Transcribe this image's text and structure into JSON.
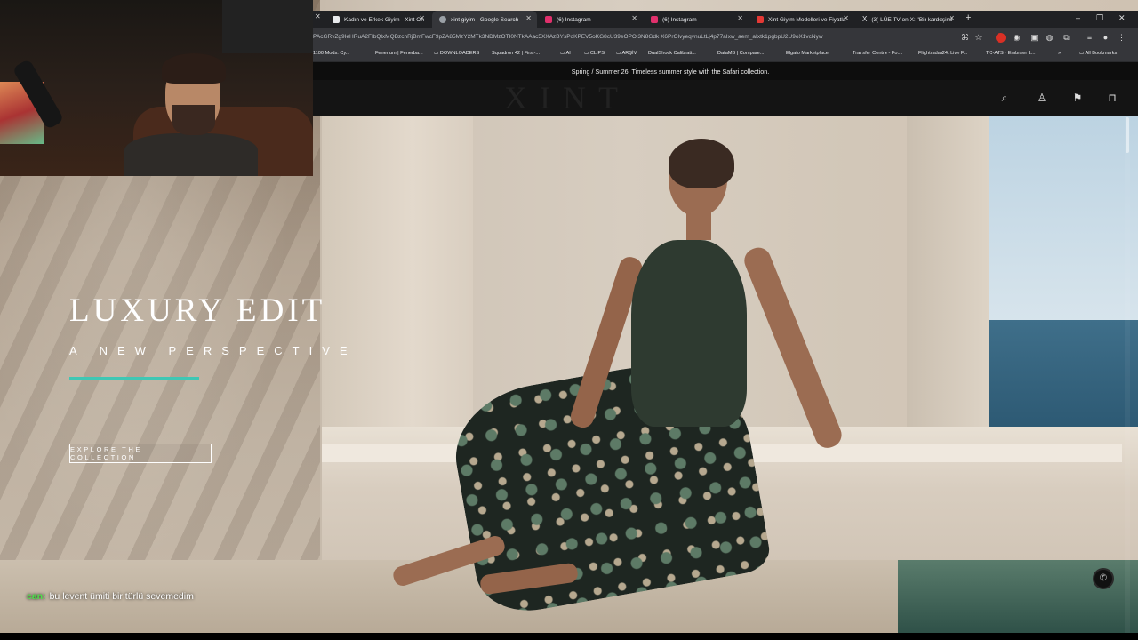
{
  "browser": {
    "tabs": [
      {
        "label": "Kadın ve Erkek Giyim - Xint On",
        "favicon_color": "#e8eaed"
      },
      {
        "label": "xint giyim - Google Search",
        "favicon_color": "#9aa0a6"
      },
      {
        "label": "(6) Instagram",
        "favicon_color": "#e1306c"
      },
      {
        "label": "(6) Instagram",
        "favicon_color": "#e1306c"
      },
      {
        "label": "Xint Giyim Modelleri ve Fiyatla",
        "favicon_color": "#e53935"
      },
      {
        "label": "(3) LÜE TV on X: \"Bir kardeşimi",
        "favicon_color": "#e8eaed"
      }
    ],
    "url": "PAcGRvZg9IeHRuA2FIbQlxMQBzcnRjBmFwcF9pZA85MzY2MTk3NDMzOTI0NTkAAac5XXAzBYsPoKPEV5oKG8cU39eOPOi3N8Gdk X6PrOlvyeqvnuLtLj4p77aIxw_aem_aIxtk1pgbpU2U9oX1vcNyw",
    "bookmarks": [
      "1100 Mods. Cy...",
      "Fenerium | Fenerba...",
      "DOWNLOADERS",
      "Squadron 42 | First-...",
      "AI",
      "CLIPS",
      "ARŞİV",
      "DualShock Calibrati...",
      "DataMB | Compare...",
      "Elgato Marketplace",
      "Transfer Centre - Fo...",
      "Flightradar24: Live F...",
      "TC-ATS - Embraer L...",
      "»",
      "All Bookmarks"
    ]
  },
  "site": {
    "promo": "Spring / Summer 26: Timeless summer style with the Safari collection.",
    "logo": "XINT",
    "hero_title": "LUXURY EDIT",
    "hero_subtitle": "A NEW PERSPECTIVE",
    "cta": "EXPLORE THE COLLECTION",
    "accent": "#3fc7b4"
  },
  "chat": {
    "user": "can:",
    "message": "bu levent ümiti bir türlü sevemedim",
    "user_color": "#4ee04a"
  }
}
